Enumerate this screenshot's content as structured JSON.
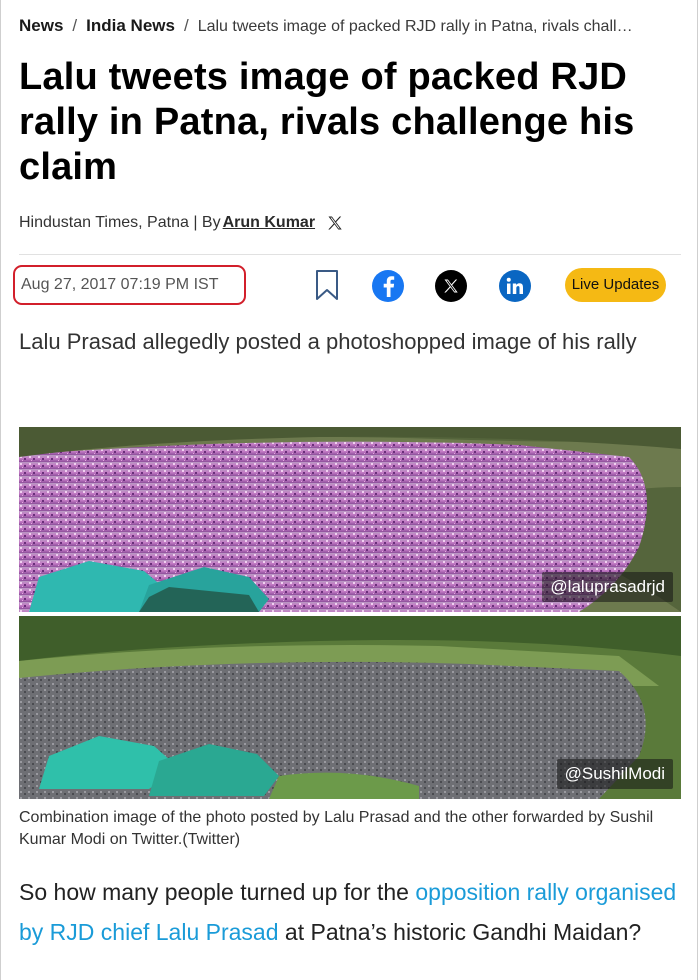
{
  "breadcrumb": {
    "items": [
      "News",
      "India News"
    ],
    "separator": "/",
    "current": "Lalu tweets image of packed RJD rally in Patna, rivals chall…"
  },
  "article": {
    "headline": "Lalu tweets image of packed RJD rally in Patna, rivals challenge his claim",
    "byline_prefix": "Hindustan Times, Patna | By",
    "author": "Arun Kumar",
    "timestamp": "Aug 27, 2017 07:19 PM IST",
    "summary": "Lalu Prasad allegedly posted a photoshopped image of his rally",
    "image_credit_top": "@laluprasadrjd",
    "image_credit_bottom": "@SushilModi",
    "caption": "Combination image of the photo posted by Lalu Prasad and the other forwarded by Sushil Kumar Modi on Twitter.(Twitter)",
    "body_text_before": "So how many people turned up for the ",
    "body_link": "opposition rally organised by RJD chief Lalu Prasad",
    "body_text_after": " at Patna’s historic Gandhi Maidan?"
  },
  "share": {
    "icons": [
      "bookmark-icon",
      "facebook-icon",
      "x-icon",
      "linkedin-icon"
    ],
    "live_updates_label": "Live Updates"
  },
  "colors": {
    "highlight_border": "#d21f2b",
    "live_button": "#f5b914",
    "link": "#1a9bd8",
    "facebook": "#1877f2",
    "linkedin": "#0a66c2"
  }
}
